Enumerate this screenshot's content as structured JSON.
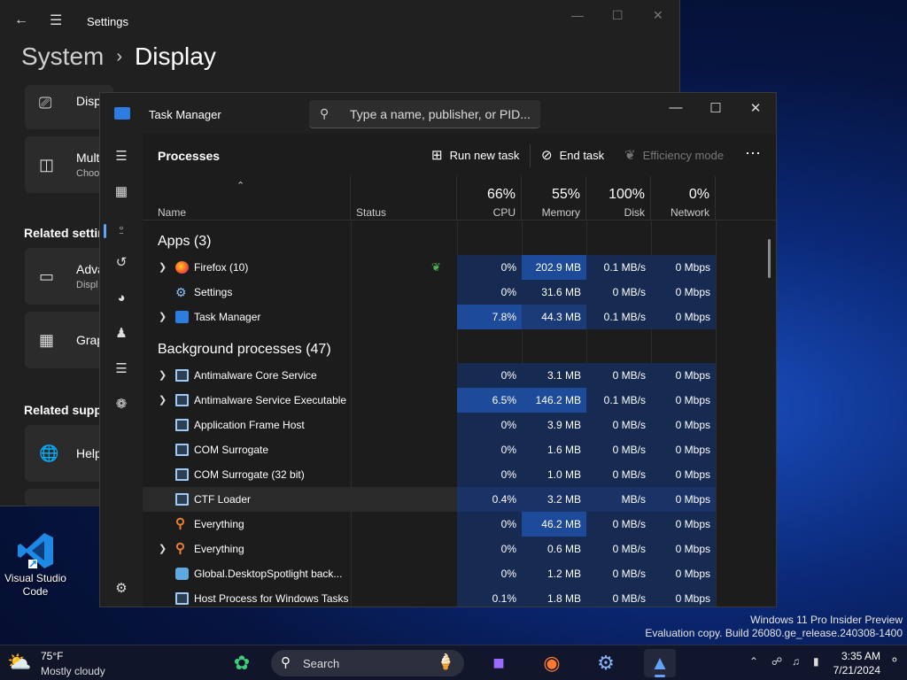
{
  "settings": {
    "title": "Settings",
    "breadcrumb": {
      "parent": "System",
      "current": "Display"
    },
    "cards": [
      {
        "title": "Disp",
        "sub": ""
      },
      {
        "title": "Mult",
        "sub": "Choo"
      },
      {
        "title": "Adva",
        "sub": "Displ"
      },
      {
        "title": "Grap",
        "sub": ""
      },
      {
        "title": "Help",
        "sub": ""
      }
    ],
    "section_related_settings": "Related settin",
    "section_related_support": "Related suppo"
  },
  "desktop": {
    "vscode_label_1": "Visual Studio",
    "vscode_label_2": "Code"
  },
  "watermark": {
    "line1": "Windows 11 Pro Insider Preview",
    "line2": "Evaluation copy. Build 26080.ge_release.240308-1400"
  },
  "taskmanager": {
    "title": "Task Manager",
    "search_placeholder": "Type a name, publisher, or PID...",
    "page_title": "Processes",
    "toolbar": {
      "run_new_task": "Run new task",
      "end_task": "End task",
      "efficiency_mode": "Efficiency mode"
    },
    "columns": {
      "name": "Name",
      "status": "Status",
      "cpu_pct": "66%",
      "cpu": "CPU",
      "mem_pct": "55%",
      "mem": "Memory",
      "disk_pct": "100%",
      "disk": "Disk",
      "net_pct": "0%",
      "net": "Network"
    },
    "groups": {
      "apps": "Apps (3)",
      "background": "Background processes (47)"
    },
    "apps": [
      {
        "name": "Firefox (10)",
        "cpu": "0%",
        "mem": "202.9 MB",
        "disk": "0.1 MB/s",
        "net": "0 Mbps"
      },
      {
        "name": "Settings",
        "cpu": "0%",
        "mem": "31.6 MB",
        "disk": "0 MB/s",
        "net": "0 Mbps"
      },
      {
        "name": "Task Manager",
        "cpu": "7.8%",
        "mem": "44.3 MB",
        "disk": "0.1 MB/s",
        "net": "0 Mbps"
      }
    ],
    "background": [
      {
        "name": "Antimalware Core Service",
        "cpu": "0%",
        "mem": "3.1 MB",
        "disk": "0 MB/s",
        "net": "0 Mbps"
      },
      {
        "name": "Antimalware Service Executable",
        "cpu": "6.5%",
        "mem": "146.2 MB",
        "disk": "0.1 MB/s",
        "net": "0 Mbps"
      },
      {
        "name": "Application Frame Host",
        "cpu": "0%",
        "mem": "3.9 MB",
        "disk": "0 MB/s",
        "net": "0 Mbps"
      },
      {
        "name": "COM Surrogate",
        "cpu": "0%",
        "mem": "1.6 MB",
        "disk": "0 MB/s",
        "net": "0 Mbps"
      },
      {
        "name": "COM Surrogate (32 bit)",
        "cpu": "0%",
        "mem": "1.0 MB",
        "disk": "0 MB/s",
        "net": "0 Mbps"
      },
      {
        "name": "CTF Loader",
        "cpu": "0.4%",
        "mem": "3.2 MB",
        "disk": "MB/s",
        "net": "0 Mbps"
      },
      {
        "name": "Everything",
        "cpu": "0%",
        "mem": "46.2 MB",
        "disk": "0 MB/s",
        "net": "0 Mbps"
      },
      {
        "name": "Everything",
        "cpu": "0%",
        "mem": "0.6 MB",
        "disk": "0 MB/s",
        "net": "0 Mbps"
      },
      {
        "name": "Global.DesktopSpotlight back...",
        "cpu": "0%",
        "mem": "1.2 MB",
        "disk": "0 MB/s",
        "net": "0 Mbps"
      },
      {
        "name": "Host Process for Windows Tasks",
        "cpu": "0.1%",
        "mem": "1.8 MB",
        "disk": "0 MB/s",
        "net": "0 Mbps"
      }
    ]
  },
  "taskbar": {
    "weather_temp": "75°F",
    "weather_desc": "Mostly cloudy",
    "search_label": "Search",
    "time": "3:35 AM",
    "date": "7/21/2024"
  },
  "colors": {
    "accent": "#60a5fa",
    "heat_light": "#162a52",
    "heat_mid": "#1a3a78",
    "heat_strong": "#1e4a9a"
  }
}
